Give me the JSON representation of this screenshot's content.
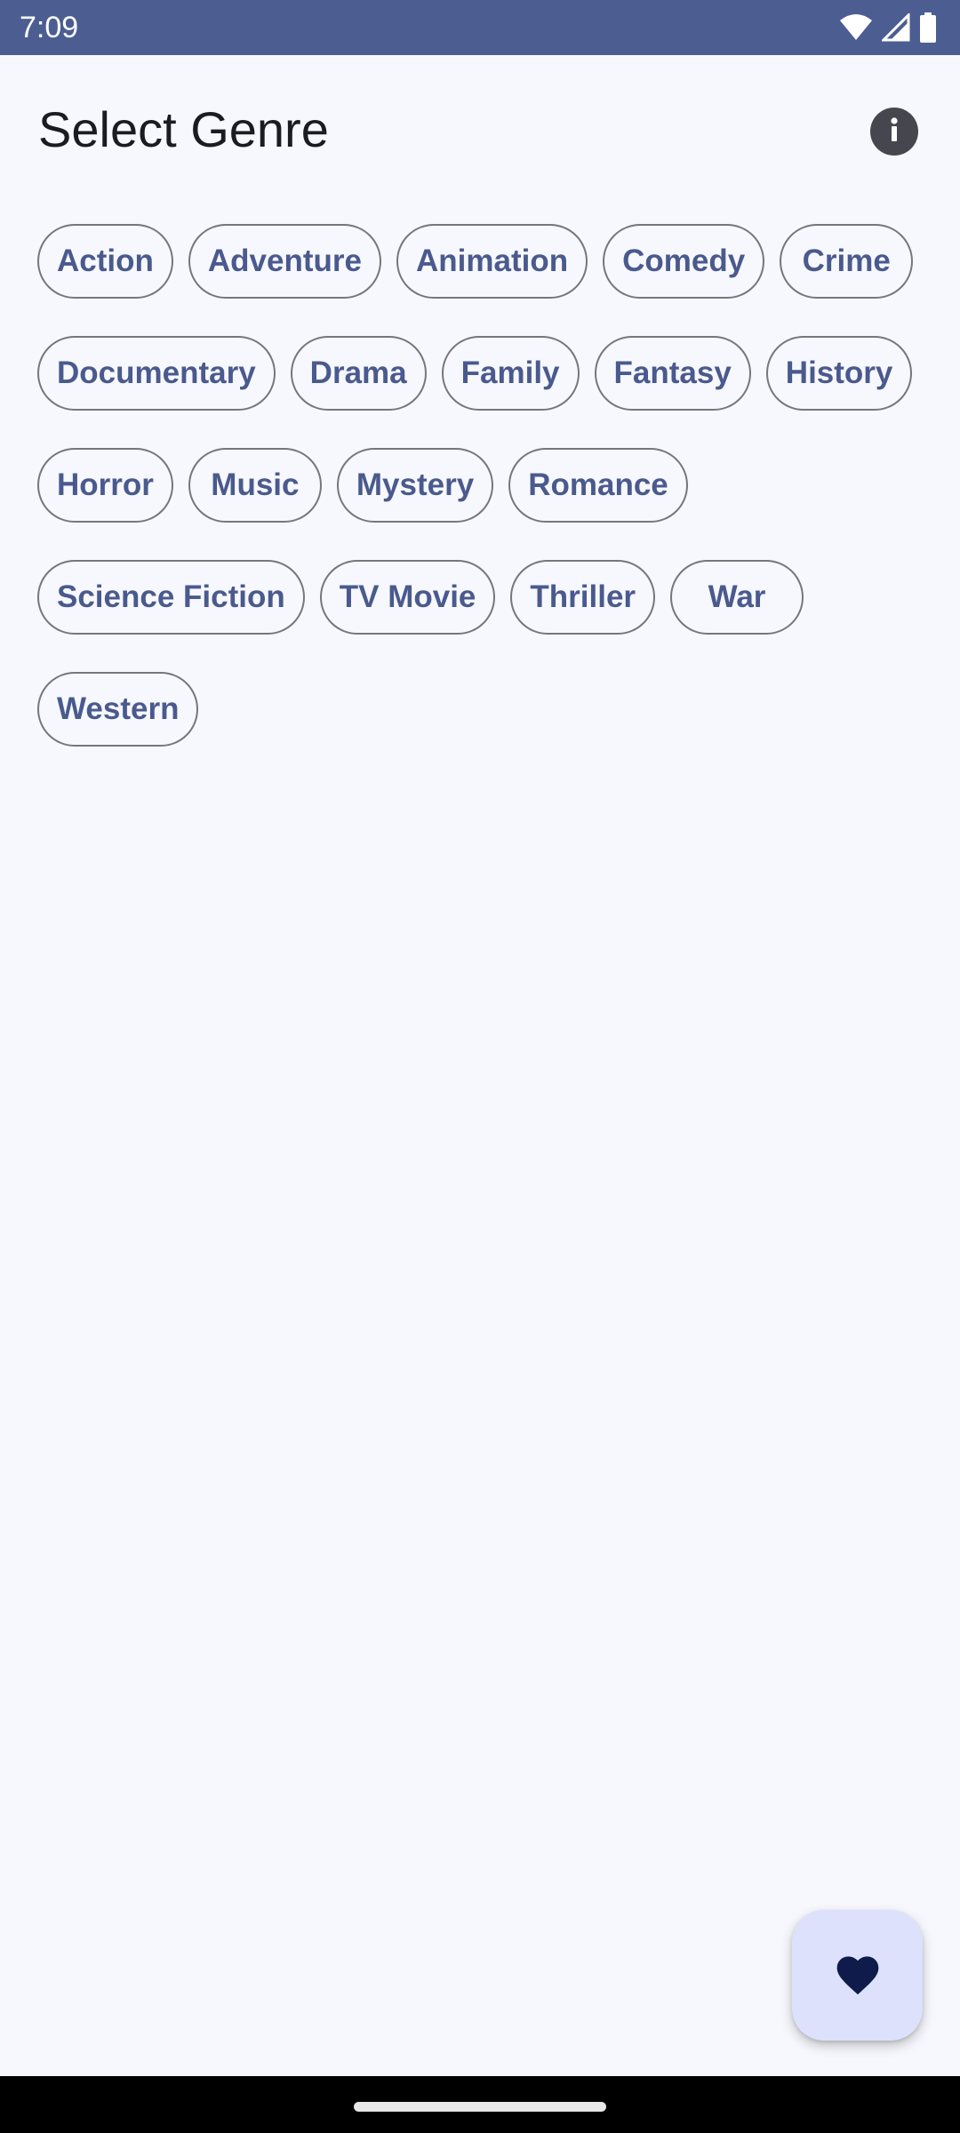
{
  "status_bar": {
    "time": "7:09",
    "icons": [
      "wifi-icon",
      "cell-signal-icon",
      "battery-icon"
    ]
  },
  "header": {
    "title": "Select Genre",
    "info_icon": "info-icon"
  },
  "genres": [
    "Action",
    "Adventure",
    "Animation",
    "Comedy",
    "Crime",
    "Documentary",
    "Drama",
    "Family",
    "Fantasy",
    "History",
    "Horror",
    "Music",
    "Mystery",
    "Romance",
    "Science Fiction",
    "TV Movie",
    "Thriller",
    "War",
    "Western"
  ],
  "fab": {
    "icon": "heart-icon"
  },
  "colors": {
    "status_bar": "#4c5d92",
    "background": "#f7f8fd",
    "chip_text": "#4a5a8e",
    "chip_border": "#767680",
    "fab_background": "#dde1fb",
    "fab_icon": "#0f1b4a"
  }
}
